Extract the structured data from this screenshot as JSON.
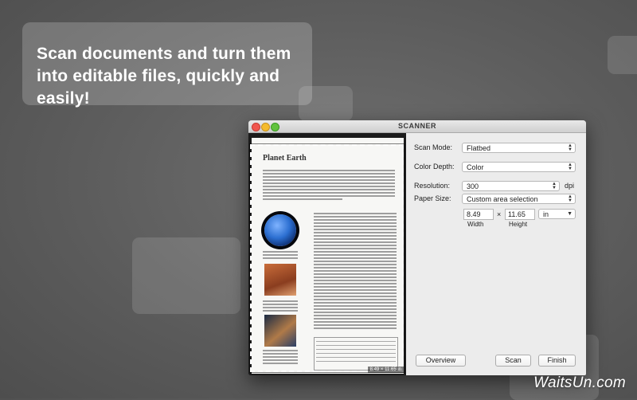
{
  "headline": "Scan documents and turn them into editable files, quickly and easily!",
  "window": {
    "title": "SCANNER"
  },
  "preview": {
    "doc_title": "Planet Earth",
    "size_tag": "8.49 × 11.65 in"
  },
  "settings": {
    "scan_mode": {
      "label": "Scan Mode:",
      "value": "Flatbed"
    },
    "color_depth": {
      "label": "Color Depth:",
      "value": "Color"
    },
    "resolution": {
      "label": "Resolution:",
      "value": "300",
      "unit": "dpi"
    },
    "paper_size": {
      "label": "Paper Size:",
      "value": "Custom area selection"
    },
    "width": {
      "value": "8.49",
      "caption": "Width"
    },
    "height": {
      "value": "11.65",
      "caption": "Height"
    },
    "times": "×",
    "units": {
      "value": "in"
    }
  },
  "buttons": {
    "overview": "Overview",
    "scan": "Scan",
    "finish": "Finish"
  },
  "watermark": "WaitsUn.com"
}
